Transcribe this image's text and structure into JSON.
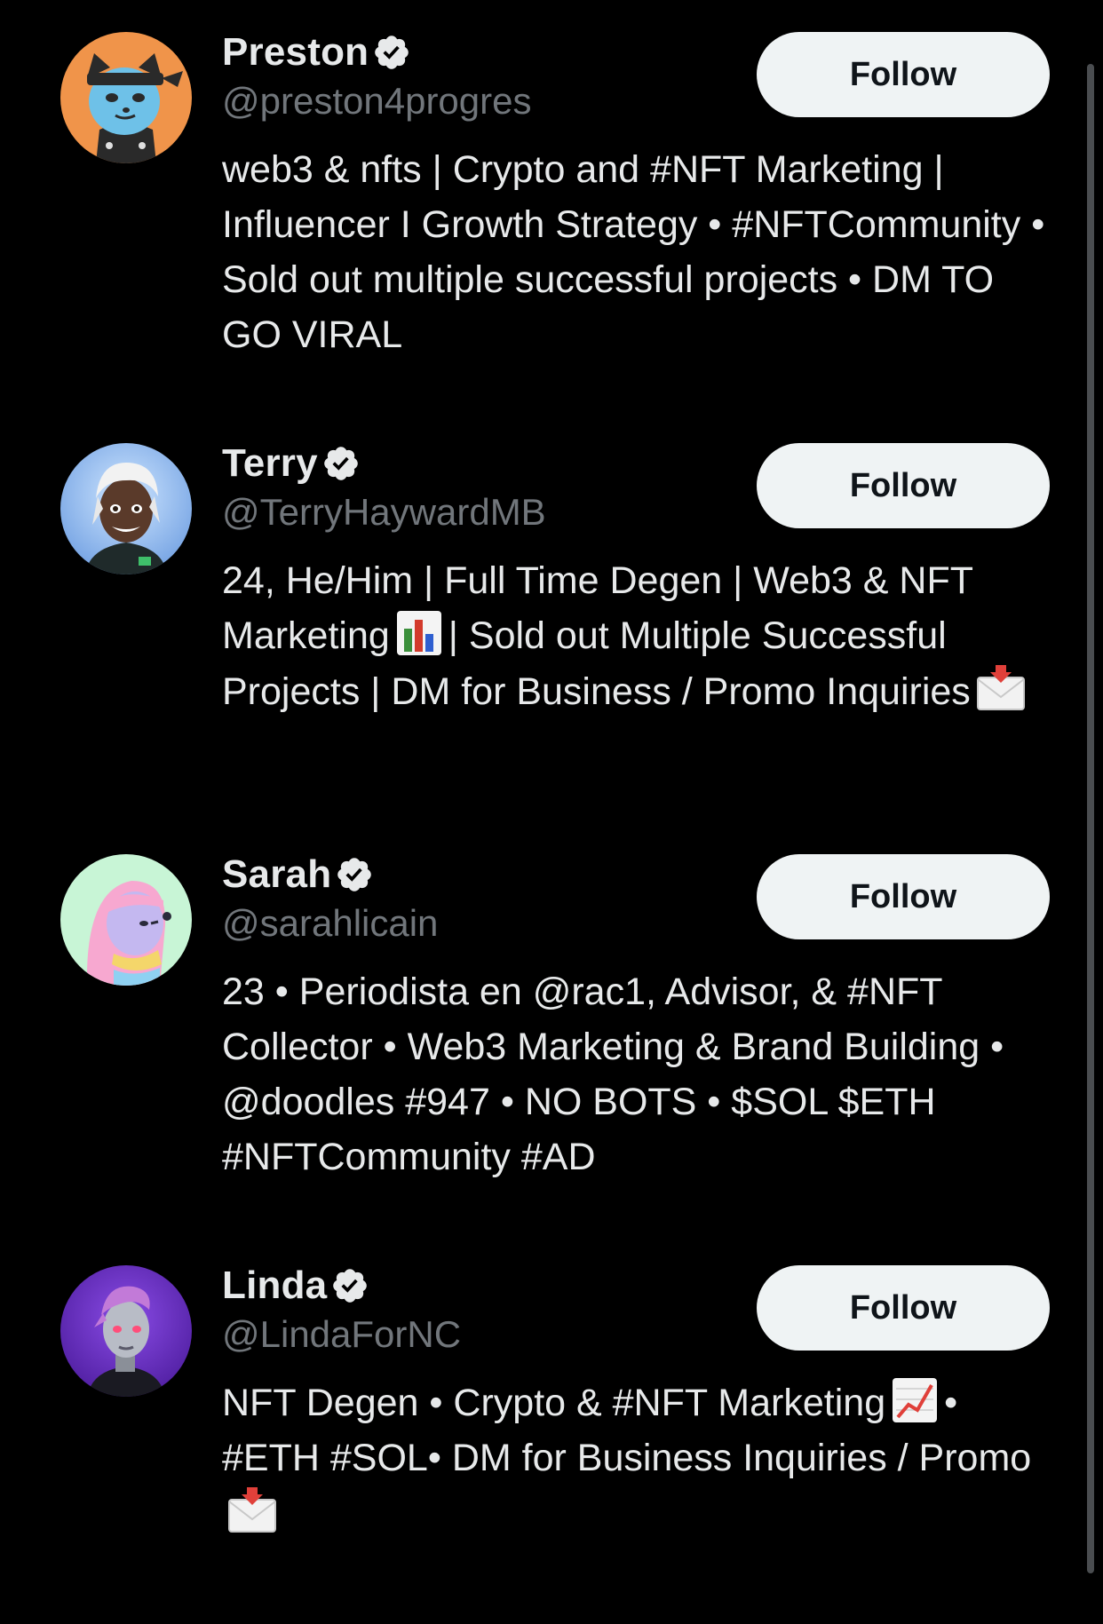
{
  "colors": {
    "background": "#000000",
    "text_primary": "#e7e9ea",
    "text_secondary": "#71767b",
    "button_bg": "#eff3f4",
    "button_text": "#0f1419"
  },
  "follow_label": "Follow",
  "users": [
    {
      "name": "Preston",
      "handle": "@preston4progres",
      "verified": true,
      "avatar": "cartoon-cat-ninja-avatar",
      "bio": "web3 & nfts | Crypto and #NFT Marketing | Influencer I Growth Strategy • #NFTCommunity • Sold out multiple successful projects • DM TO GO VIRAL"
    },
    {
      "name": "Terry",
      "handle": "@TerryHaywardMB",
      "verified": true,
      "avatar": "3d-character-avatar",
      "bio_part1": "24, He/Him | Full Time Degen | Web3 & NFT Marketing",
      "bio_emoji1": "bar-chart-emoji",
      "bio_part2": "| Sold out Multiple Successful Projects | DM for Business / Promo Inquiries",
      "bio_emoji2": "incoming-envelope-emoji"
    },
    {
      "name": "Sarah",
      "handle": "@sarahlicain",
      "verified": true,
      "avatar": "doodle-avatar",
      "bio": "23 • Periodista en @rac1, Advisor, & #NFT Collector • Web3 Marketing & Brand Building • @doodles #947 • NO BOTS • $SOL $ETH #NFTCommunity #AD"
    },
    {
      "name": "Linda",
      "handle": "@LindaForNC",
      "verified": true,
      "avatar": "3d-robot-woman-avatar",
      "bio_part1": "NFT Degen • Crypto & #NFT Marketing",
      "bio_emoji1": "chart-increasing-emoji",
      "bio_part2": "• #ETH #SOL• DM for Business Inquiries / Promo",
      "bio_emoji2": "incoming-envelope-emoji"
    }
  ]
}
